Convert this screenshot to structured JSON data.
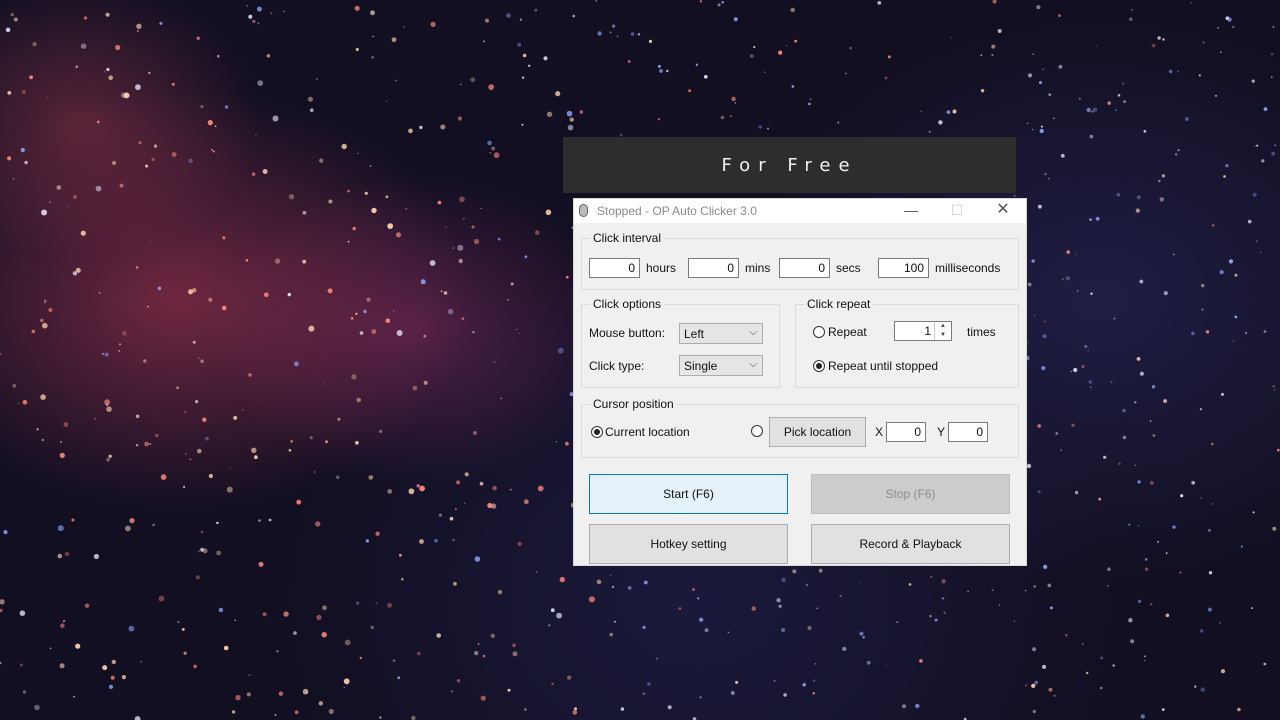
{
  "banner": {
    "text": "For Free"
  },
  "window": {
    "title": "Stopped - OP Auto Clicker 3.0",
    "controls": {
      "minimize": "—",
      "maximize": "☐",
      "close": "✕"
    }
  },
  "click_interval": {
    "label": "Click interval",
    "hours": {
      "value": "0",
      "unit": "hours"
    },
    "mins": {
      "value": "0",
      "unit": "mins"
    },
    "secs": {
      "value": "0",
      "unit": "secs"
    },
    "milliseconds": {
      "value": "100",
      "unit": "milliseconds"
    }
  },
  "click_options": {
    "label": "Click options",
    "mouse_button_label": "Mouse button:",
    "mouse_button_value": "Left",
    "click_type_label": "Click type:",
    "click_type_value": "Single"
  },
  "click_repeat": {
    "label": "Click repeat",
    "repeat_label": "Repeat",
    "repeat_value": "1",
    "times_label": "times",
    "repeat_until_stopped_label": "Repeat until stopped",
    "selected": "repeat_until_stopped"
  },
  "cursor_position": {
    "label": "Cursor position",
    "current_location_label": "Current location",
    "pick_location_label": "Pick location",
    "x_label": "X",
    "x_value": "0",
    "y_label": "Y",
    "y_value": "0",
    "selected": "current_location"
  },
  "buttons": {
    "start": "Start (F6)",
    "stop": "Stop (F6)",
    "hotkey": "Hotkey setting",
    "record": "Record & Playback"
  },
  "colors": {
    "accent": "#0078d7",
    "banner_bg": "#2d2d2d"
  }
}
